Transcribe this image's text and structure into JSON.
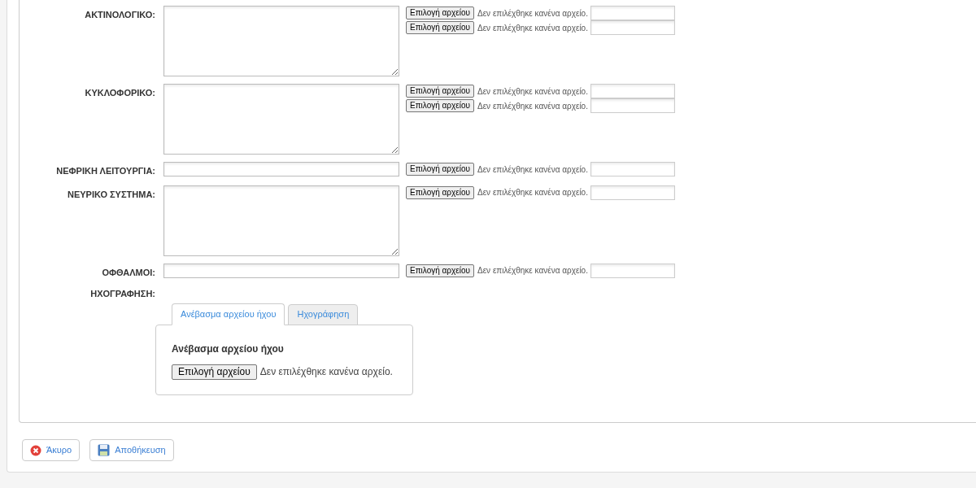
{
  "fields": [
    {
      "label": "ΑΚΤΙΝΟΛΟΓΙΚΟ:",
      "kind": "textarea",
      "uploads": [
        {
          "button": "Επιλογή αρχείου",
          "status": "Δεν επιλέχθηκε κανένα αρχείο."
        },
        {
          "button": "Επιλογή αρχείου",
          "status": "Δεν επιλέχθηκε κανένα αρχείο."
        }
      ]
    },
    {
      "label": "ΚΥΚΛΟΦΟΡΙΚΟ:",
      "kind": "textarea",
      "uploads": [
        {
          "button": "Επιλογή αρχείου",
          "status": "Δεν επιλέχθηκε κανένα αρχείο."
        },
        {
          "button": "Επιλογή αρχείου",
          "status": "Δεν επιλέχθηκε κανένα αρχείο."
        }
      ]
    },
    {
      "label": "ΝΕΦΡΙΚΗ ΛΕΙΤΟΥΡΓΙΑ:",
      "kind": "input",
      "uploads": [
        {
          "button": "Επιλογή αρχείου",
          "status": "Δεν επιλέχθηκε κανένα αρχείο."
        }
      ]
    },
    {
      "label": "ΝΕΥΡΙΚΟ ΣΥΣΤΗΜΑ:",
      "kind": "textarea",
      "uploads": [
        {
          "button": "Επιλογή αρχείου",
          "status": "Δεν επιλέχθηκε κανένα αρχείο."
        }
      ]
    },
    {
      "label": "ΟΦΘΑΛΜΟΙ:",
      "kind": "input",
      "uploads": [
        {
          "button": "Επιλογή αρχείου",
          "status": "Δεν επιλέχθηκε κανένα αρχείο."
        }
      ]
    }
  ],
  "audio": {
    "label": "ΗΧΟΓΡΑΦΗΣΗ:",
    "tabs": [
      {
        "label": "Ανέβασμα αρχείου ήχου",
        "selected": true
      },
      {
        "label": "Ηχογράφηση",
        "selected": false
      }
    ],
    "panel_title": "Ανέβασμα αρχείου ήχου",
    "upload": {
      "button": "Επιλογή αρχείου",
      "status": "Δεν επιλέχθηκε κανένα αρχείο."
    }
  },
  "actions": [
    {
      "kind": "cancel",
      "label": "Άκυρο"
    },
    {
      "kind": "save",
      "label": "Αποθήκευση"
    }
  ]
}
